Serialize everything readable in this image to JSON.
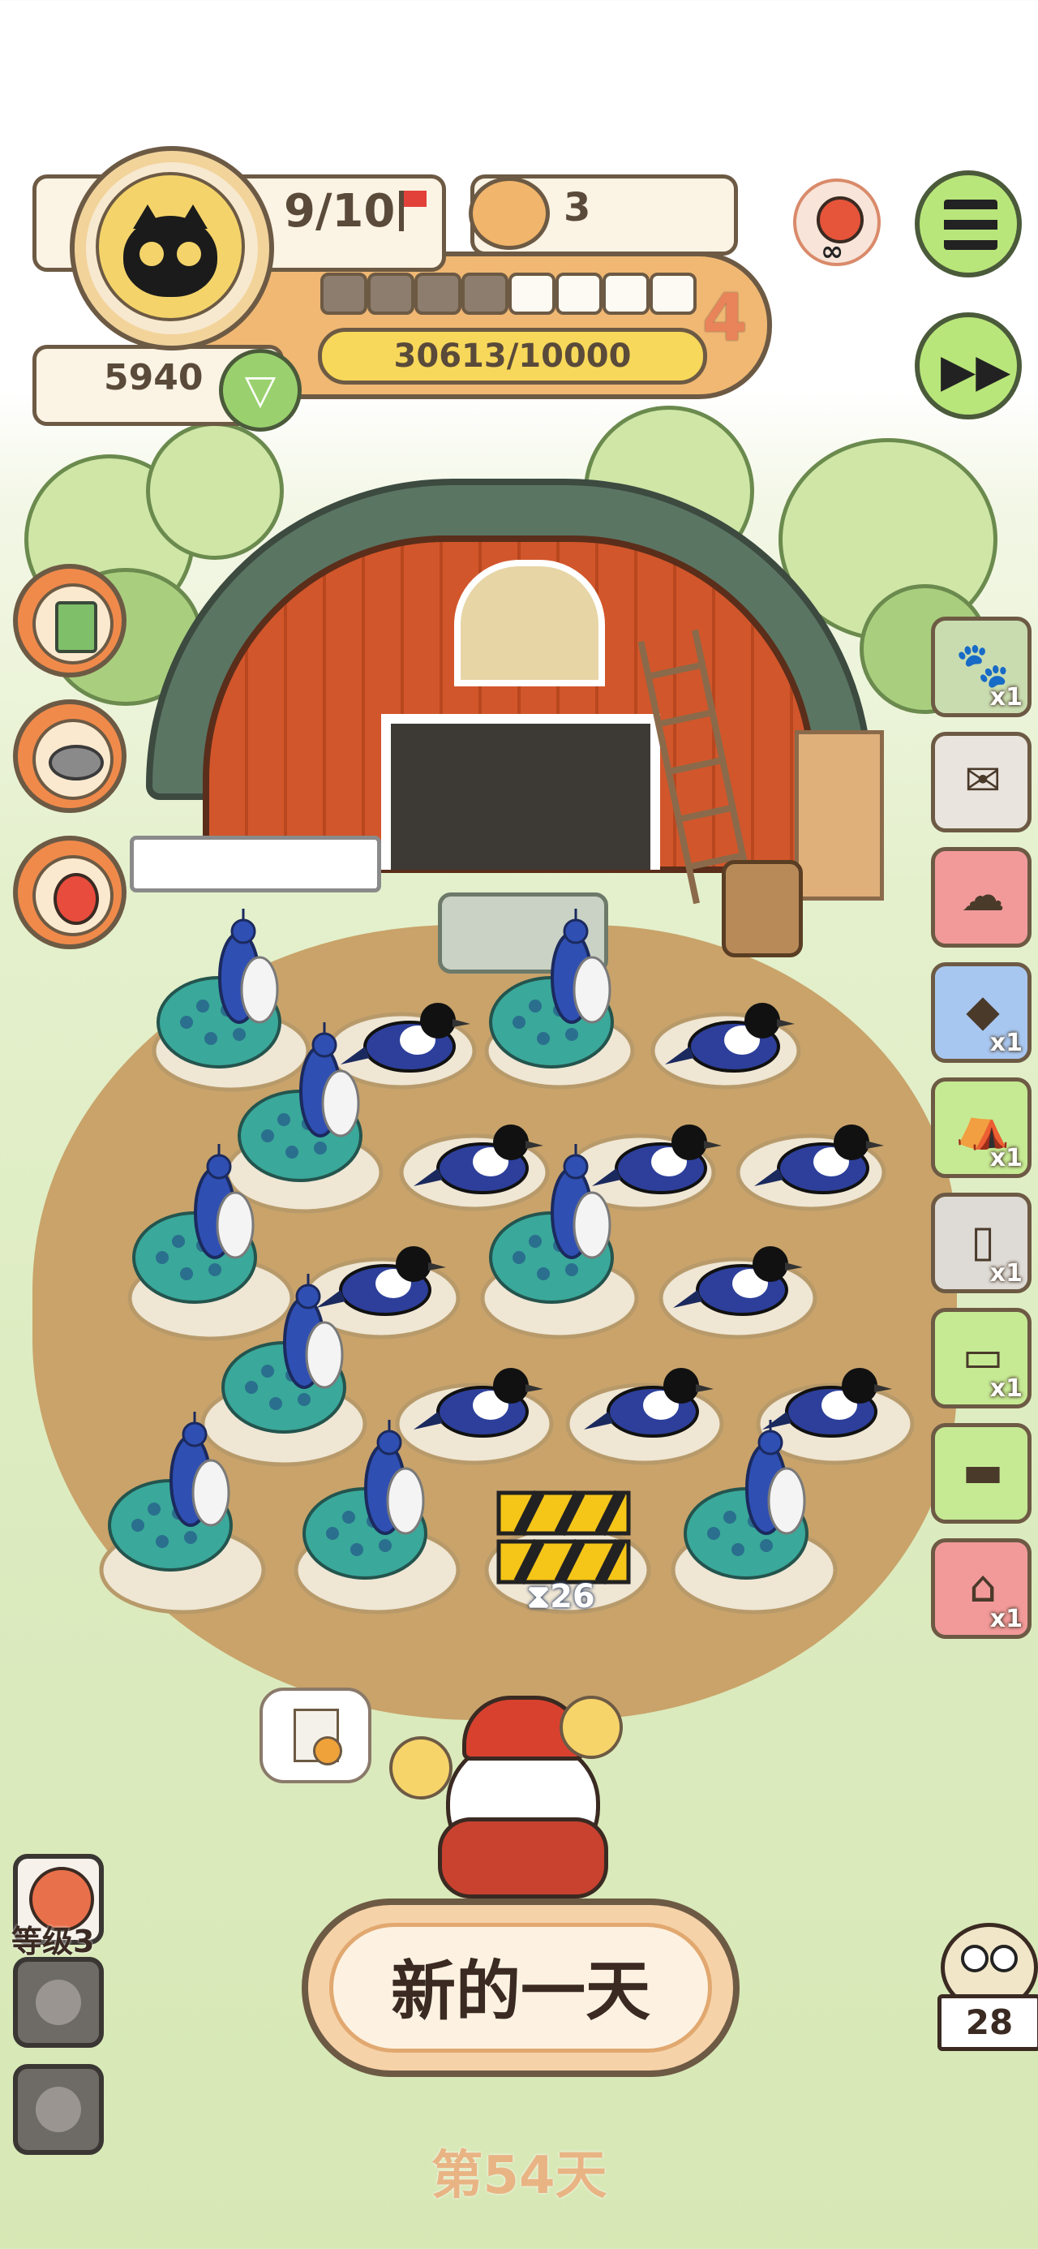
{
  "hud": {
    "energy": "9/10",
    "food_count": "3",
    "currency": "5940",
    "level_number": "4",
    "progress_segments": {
      "filled": 4,
      "total": 8
    },
    "experience": "30613/10000"
  },
  "construction_timer": "26",
  "side_cards": [
    {
      "id": "paw-card",
      "count": "x1",
      "color": "#c9dcb0"
    },
    {
      "id": "mail",
      "count": "",
      "color": "#e9e4dd"
    },
    {
      "id": "cloud",
      "count": "",
      "color": "#f29a9a"
    },
    {
      "id": "seed-bag",
      "count": "x1",
      "color": "#a8c7f0"
    },
    {
      "id": "tent",
      "count": "x1",
      "color": "#c6ea94"
    },
    {
      "id": "jar",
      "count": "x1",
      "color": "#dedad6"
    },
    {
      "id": "ticket",
      "count": "x1",
      "color": "#c6ea94"
    },
    {
      "id": "card",
      "count": "",
      "color": "#c6ea94"
    },
    {
      "id": "birdcage",
      "count": "x1",
      "color": "#f29a9a"
    }
  ],
  "bottom_left": {
    "level_label": "等级3"
  },
  "owl_count": "28",
  "main_button": "新的一天",
  "day_label": "第54天"
}
